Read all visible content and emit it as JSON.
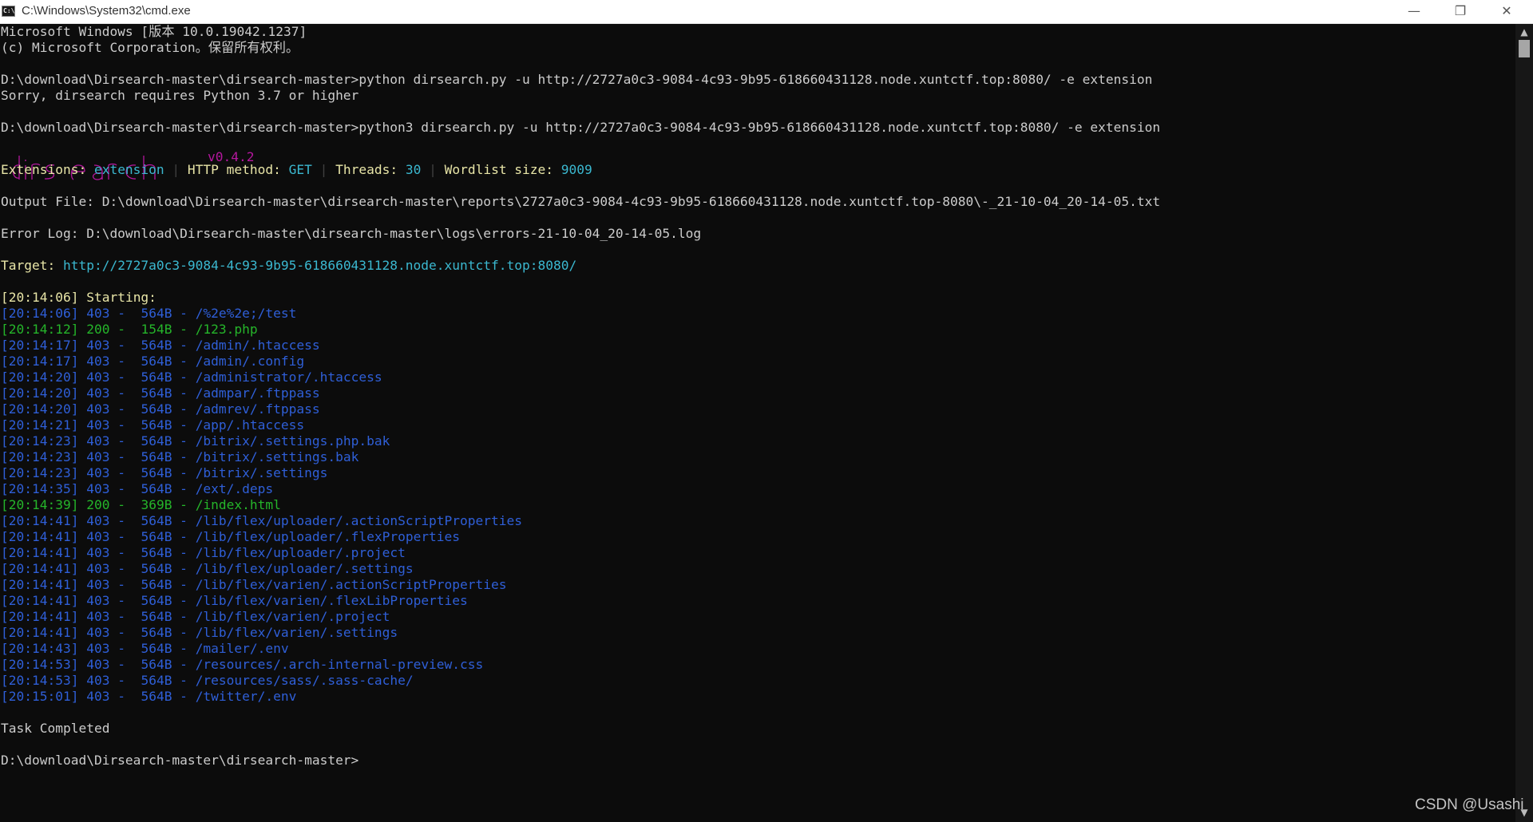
{
  "window": {
    "title": "C:\\Windows\\System32\\cmd.exe",
    "icon": "cmd-icon",
    "icon_text": "C:\\",
    "buttons": {
      "minimize": "—",
      "maximize": "❐",
      "close": "✕"
    }
  },
  "colors": {
    "background": "#0c0c0c",
    "default_text": "#cccccc",
    "blue": "#2f5fd8",
    "green": "#25b52a",
    "cyan": "#3bb8d0",
    "yellow": "#e8e5a7",
    "magenta": "#b5179e"
  },
  "header_lines": [
    "Microsoft Windows [版本 10.0.19042.1237]",
    "(c) Microsoft Corporation。保留所有权利。"
  ],
  "commands": [
    {
      "prompt": "D:\\download\\Dirsearch-master\\dirsearch-master>",
      "command": "python dirsearch.py -u http://2727a0c3-9084-4c93-9b95-618660431128.node.xuntctf.top:8080/ -e extension",
      "output": "Sorry, dirsearch requires Python 3.7 or higher"
    },
    {
      "prompt": "D:\\download\\Dirsearch-master\\dirsearch-master>",
      "command": "python3 dirsearch.py -u http://2727a0c3-9084-4c93-9b95-618660431128.node.xuntctf.top:8080/ -e extension"
    }
  ],
  "banner": {
    "logo": "dirsearch",
    "version": "v0.4.2"
  },
  "config": {
    "extensions_label": "Extensions: ",
    "extensions_value": "extension",
    "method_label": "HTTP method: ",
    "method_value": "GET",
    "threads_label": "Threads: ",
    "threads_value": "30",
    "wordlist_label": "Wordlist size: ",
    "wordlist_value": "9009",
    "separator": "|"
  },
  "output_file": "Output File: D:\\download\\Dirsearch-master\\dirsearch-master\\reports\\2727a0c3-9084-4c93-9b95-618660431128.node.xuntctf.top-8080\\-_21-10-04_20-14-05.txt",
  "error_log": "Error Log: D:\\download\\Dirsearch-master\\dirsearch-master\\logs\\errors-21-10-04_20-14-05.log",
  "target": {
    "label": "Target: ",
    "url": "http://2727a0c3-9084-4c93-9b95-618660431128.node.xuntctf.top:8080/"
  },
  "start": {
    "time": "[20:14:06]",
    "text": " Starting:"
  },
  "results": [
    {
      "time": "[20:14:06]",
      "status": "403",
      "size": "564B",
      "path": "/%2e%2e;/test"
    },
    {
      "time": "[20:14:12]",
      "status": "200",
      "size": "154B",
      "path": "/123.php"
    },
    {
      "time": "[20:14:17]",
      "status": "403",
      "size": "564B",
      "path": "/admin/.htaccess"
    },
    {
      "time": "[20:14:17]",
      "status": "403",
      "size": "564B",
      "path": "/admin/.config"
    },
    {
      "time": "[20:14:20]",
      "status": "403",
      "size": "564B",
      "path": "/administrator/.htaccess"
    },
    {
      "time": "[20:14:20]",
      "status": "403",
      "size": "564B",
      "path": "/admpar/.ftppass"
    },
    {
      "time": "[20:14:20]",
      "status": "403",
      "size": "564B",
      "path": "/admrev/.ftppass"
    },
    {
      "time": "[20:14:21]",
      "status": "403",
      "size": "564B",
      "path": "/app/.htaccess"
    },
    {
      "time": "[20:14:23]",
      "status": "403",
      "size": "564B",
      "path": "/bitrix/.settings.php.bak"
    },
    {
      "time": "[20:14:23]",
      "status": "403",
      "size": "564B",
      "path": "/bitrix/.settings.bak"
    },
    {
      "time": "[20:14:23]",
      "status": "403",
      "size": "564B",
      "path": "/bitrix/.settings"
    },
    {
      "time": "[20:14:35]",
      "status": "403",
      "size": "564B",
      "path": "/ext/.deps"
    },
    {
      "time": "[20:14:39]",
      "status": "200",
      "size": "369B",
      "path": "/index.html"
    },
    {
      "time": "[20:14:41]",
      "status": "403",
      "size": "564B",
      "path": "/lib/flex/uploader/.actionScriptProperties"
    },
    {
      "time": "[20:14:41]",
      "status": "403",
      "size": "564B",
      "path": "/lib/flex/uploader/.flexProperties"
    },
    {
      "time": "[20:14:41]",
      "status": "403",
      "size": "564B",
      "path": "/lib/flex/uploader/.project"
    },
    {
      "time": "[20:14:41]",
      "status": "403",
      "size": "564B",
      "path": "/lib/flex/uploader/.settings"
    },
    {
      "time": "[20:14:41]",
      "status": "403",
      "size": "564B",
      "path": "/lib/flex/varien/.actionScriptProperties"
    },
    {
      "time": "[20:14:41]",
      "status": "403",
      "size": "564B",
      "path": "/lib/flex/varien/.flexLibProperties"
    },
    {
      "time": "[20:14:41]",
      "status": "403",
      "size": "564B",
      "path": "/lib/flex/varien/.project"
    },
    {
      "time": "[20:14:41]",
      "status": "403",
      "size": "564B",
      "path": "/lib/flex/varien/.settings"
    },
    {
      "time": "[20:14:43]",
      "status": "403",
      "size": "564B",
      "path": "/mailer/.env"
    },
    {
      "time": "[20:14:53]",
      "status": "403",
      "size": "564B",
      "path": "/resources/.arch-internal-preview.css"
    },
    {
      "time": "[20:14:53]",
      "status": "403",
      "size": "564B",
      "path": "/resources/sass/.sass-cache/"
    },
    {
      "time": "[20:15:01]",
      "status": "403",
      "size": "564B",
      "path": "/twitter/.env"
    }
  ],
  "completed": "Task Completed",
  "final_prompt": "D:\\download\\Dirsearch-master\\dirsearch-master>",
  "watermark": "CSDN @Usashi"
}
